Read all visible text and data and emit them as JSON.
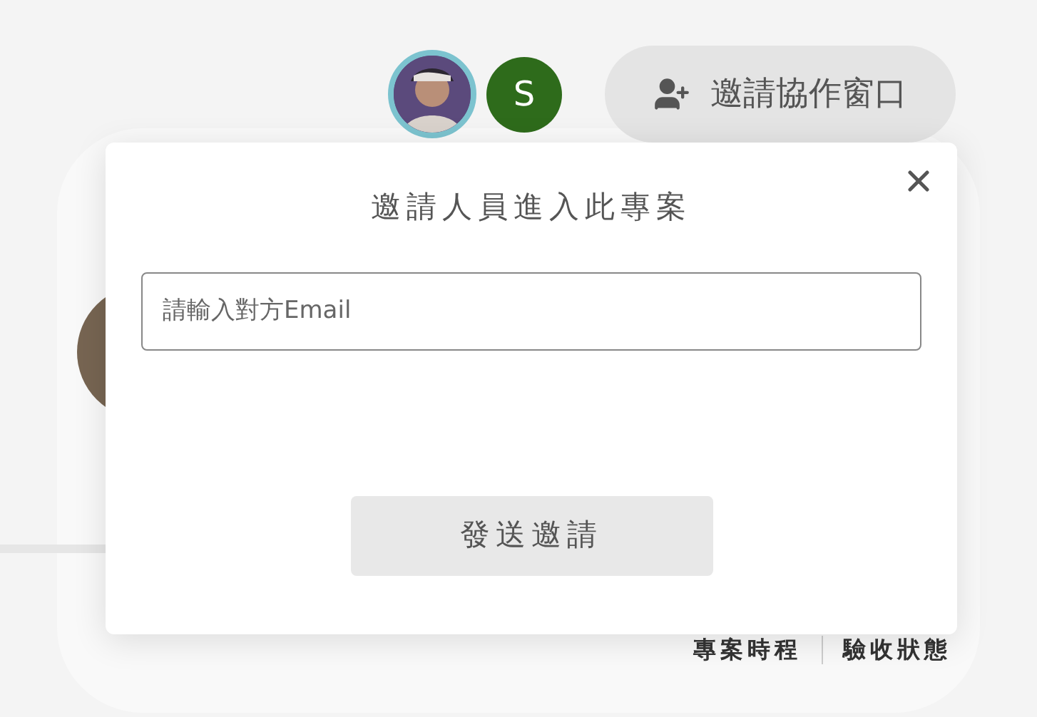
{
  "header": {
    "avatars": [
      {
        "kind": "picture"
      },
      {
        "kind": "letter",
        "letter": "S"
      }
    ],
    "invite_button": {
      "label": "邀請協作窗口"
    }
  },
  "dialog": {
    "title": "邀請人員進入此專案",
    "email_field": {
      "placeholder": "請輸入對方Email"
    },
    "submit_button": {
      "label": "發送邀請"
    }
  },
  "background": {
    "tabs": [
      {
        "label": "專案時程"
      },
      {
        "label": "驗收狀態"
      }
    ]
  }
}
